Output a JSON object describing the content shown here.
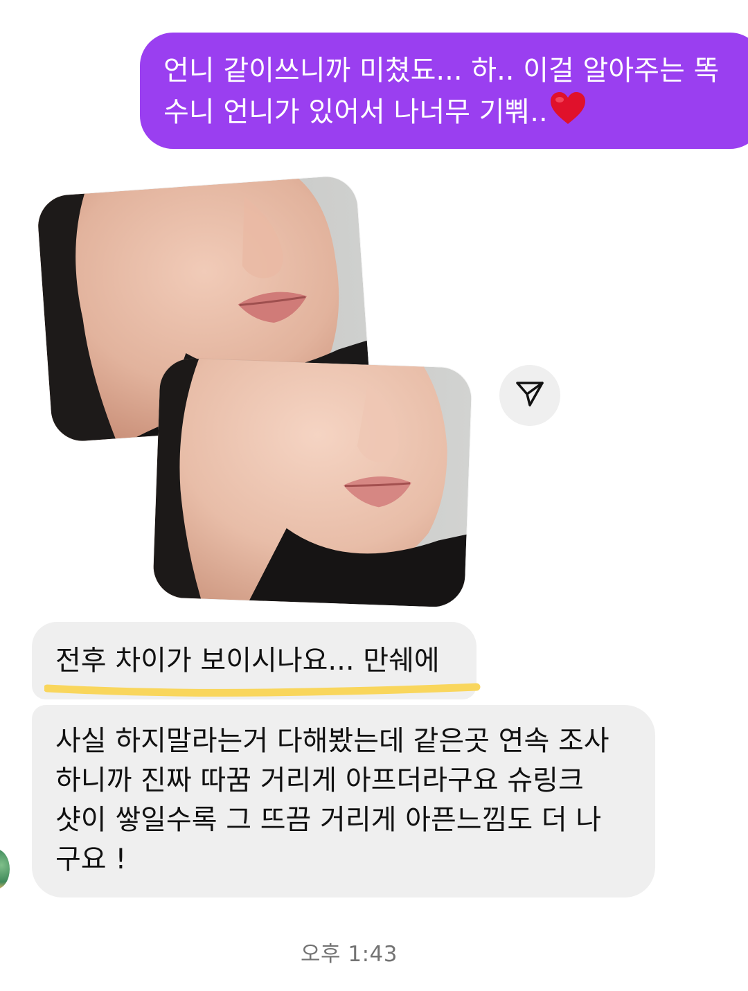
{
  "outgoing_message": {
    "line1": "언니 같이쓰니까 미쳤됴... 하.. 이걸 알아주는 똑",
    "line2": "수니 언니가 있어서 나너무 기뿨..",
    "emoji": "heart-emoji",
    "bubble_color": "#9A3FF0"
  },
  "photos": [
    {
      "icon": "face-photo-before"
    },
    {
      "icon": "face-photo-after"
    }
  ],
  "share_button": {
    "icon": "send-icon"
  },
  "incoming_messages": [
    {
      "text": "전후 차이가 보이시나요... 만쉐에"
    },
    {
      "lines": [
        "사실 하지말라는거 다해봤는데 같은곳 연속 조사",
        "하니까 진짜 따꿈 거리게 아프더라구요 슈링크",
        "샷이 쌓일수록 그 뜨끔 거리게 아픈느낌도 더 나",
        "구요 !"
      ]
    }
  ],
  "highlight_color": "#F9D65C",
  "timestamp": "오후 1:43"
}
